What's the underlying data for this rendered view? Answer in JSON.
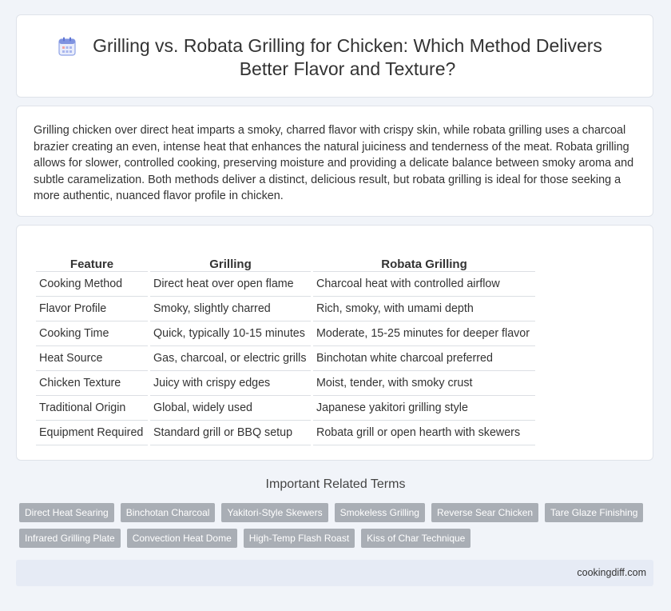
{
  "header": {
    "title": "Grilling vs. Robata Grilling for Chicken: Which Method Delivers Better Flavor and Texture?",
    "icon": "calendar-icon"
  },
  "intro": {
    "text": "Grilling chicken over direct heat imparts a smoky, charred flavor with crispy skin, while robata grilling uses a charcoal brazier creating an even, intense heat that enhances the natural juiciness and tenderness of the meat. Robata grilling allows for slower, controlled cooking, preserving moisture and providing a delicate balance between smoky aroma and subtle caramelization. Both methods deliver a distinct, delicious result, but robata grilling is ideal for those seeking a more authentic, nuanced flavor profile in chicken."
  },
  "table": {
    "headers": [
      "Feature",
      "Grilling",
      "Robata Grilling"
    ],
    "rows": [
      [
        "Cooking Method",
        "Direct heat over open flame",
        "Charcoal heat with controlled airflow"
      ],
      [
        "Flavor Profile",
        "Smoky, slightly charred",
        "Rich, smoky, with umami depth"
      ],
      [
        "Cooking Time",
        "Quick, typically 10-15 minutes",
        "Moderate, 15-25 minutes for deeper flavor"
      ],
      [
        "Heat Source",
        "Gas, charcoal, or electric grills",
        "Binchotan white charcoal preferred"
      ],
      [
        "Chicken Texture",
        "Juicy with crispy edges",
        "Moist, tender, with smoky crust"
      ],
      [
        "Traditional Origin",
        "Global, widely used",
        "Japanese yakitori grilling style"
      ],
      [
        "Equipment Required",
        "Standard grill or BBQ setup",
        "Robata grill or open hearth with skewers"
      ]
    ]
  },
  "related": {
    "title": "Important Related Terms",
    "tags": [
      "Direct Heat Searing",
      "Binchotan Charcoal",
      "Yakitori-Style Skewers",
      "Smokeless Grilling",
      "Reverse Sear Chicken",
      "Tare Glaze Finishing",
      "Infrared Grilling Plate",
      "Convection Heat Dome",
      "High-Temp Flash Roast",
      "Kiss of Char Technique"
    ]
  },
  "footer": {
    "site": "cookingdiff.com"
  }
}
